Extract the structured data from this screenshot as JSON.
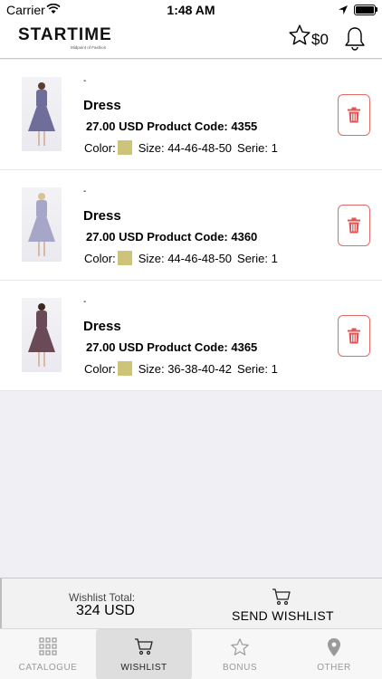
{
  "status_bar": {
    "carrier": "Carrier",
    "time": "1:48 AM"
  },
  "header": {
    "logo": "STARTIME",
    "logo_tagline": "Midpoint of Fashion",
    "total": "$0"
  },
  "items": [
    {
      "dash": "-",
      "name": "Dress",
      "price_code": "27.00 USD Product Code: 4355",
      "color_label": "Color:",
      "color": "#cdc47a",
      "size": "Size: 44-46-48-50",
      "serie": "Serie: 1",
      "dress_color": "#6f6e9b"
    },
    {
      "dash": "-",
      "name": "Dress",
      "price_code": "27.00 USD Product Code: 4360",
      "color_label": "Color:",
      "color": "#cdc47a",
      "size": "Size: 44-46-48-50",
      "serie": "Serie: 1",
      "dress_color": "#a6a6c8"
    },
    {
      "dash": "-",
      "name": "Dress",
      "price_code": "27.00 USD Product Code: 4365",
      "color_label": "Color:",
      "color": "#cdc47a",
      "size": "Size: 36-38-40-42",
      "serie": "Serie: 1",
      "dress_color": "#6b4a57"
    }
  ],
  "footer": {
    "total_label": "Wishlist Total:",
    "total_value": "324 USD",
    "send_label": "SEND WISHLIST"
  },
  "tabs": [
    {
      "label": "CATALOGUE",
      "icon": "grid-icon",
      "active": false
    },
    {
      "label": "WISHLIST",
      "icon": "cart-icon",
      "active": true
    },
    {
      "label": "BONUS",
      "icon": "star-icon",
      "active": false
    },
    {
      "label": "OTHER",
      "icon": "location-pin-icon",
      "active": false
    }
  ],
  "colors": {
    "accent_red": "#e06b6b",
    "swatch": "#cdc47a",
    "background": "#efeff4"
  }
}
